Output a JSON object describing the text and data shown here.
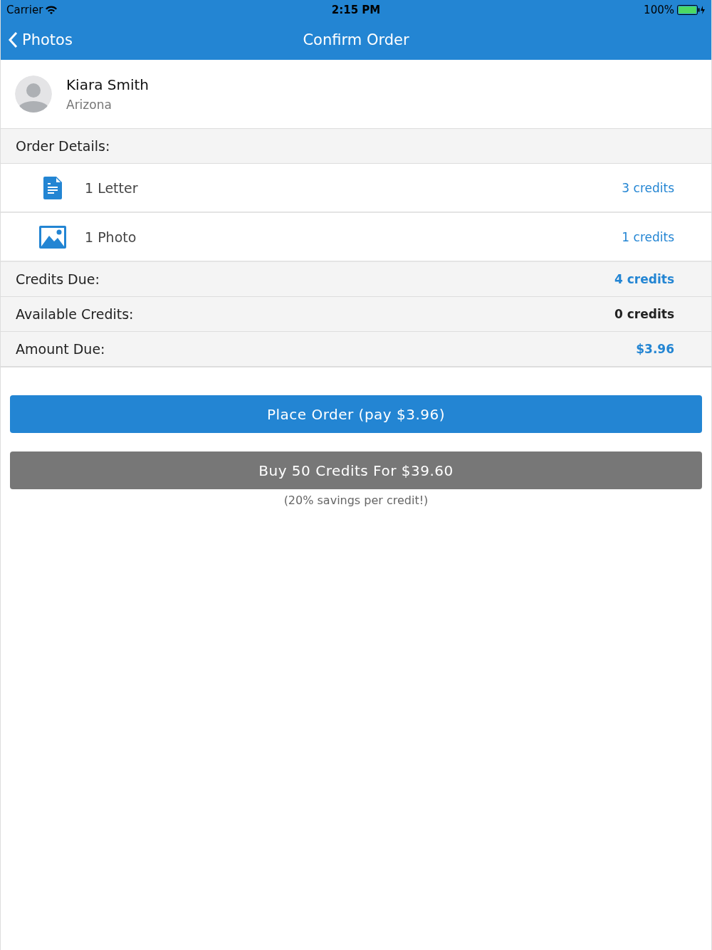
{
  "status_bar": {
    "carrier": "Carrier",
    "time": "2:15 PM",
    "battery": "100%"
  },
  "nav": {
    "back": "Photos",
    "title": "Confirm Order"
  },
  "profile": {
    "name": "Kiara Smith",
    "location": "Arizona"
  },
  "order_details": {
    "heading": "Order Details:",
    "items": [
      {
        "kind": "letter",
        "label": "1 Letter",
        "credits": "3 credits"
      },
      {
        "kind": "photo",
        "label": "1 Photo",
        "credits": "1 credits"
      }
    ]
  },
  "summary": [
    {
      "label": "Credits Due:",
      "value": "4 credits",
      "color": "#2385d3"
    },
    {
      "label": "Available Credits:",
      "value": "0 credits",
      "color": "#222222"
    },
    {
      "label": "Amount Due:",
      "value": "$3.96",
      "color": "#2385d3"
    }
  ],
  "place_order_button": "Place Order (pay $3.96)",
  "buy_credits_button": "Buy 50 Credits For $39.60",
  "savings_note": "(20% savings per credit!)"
}
